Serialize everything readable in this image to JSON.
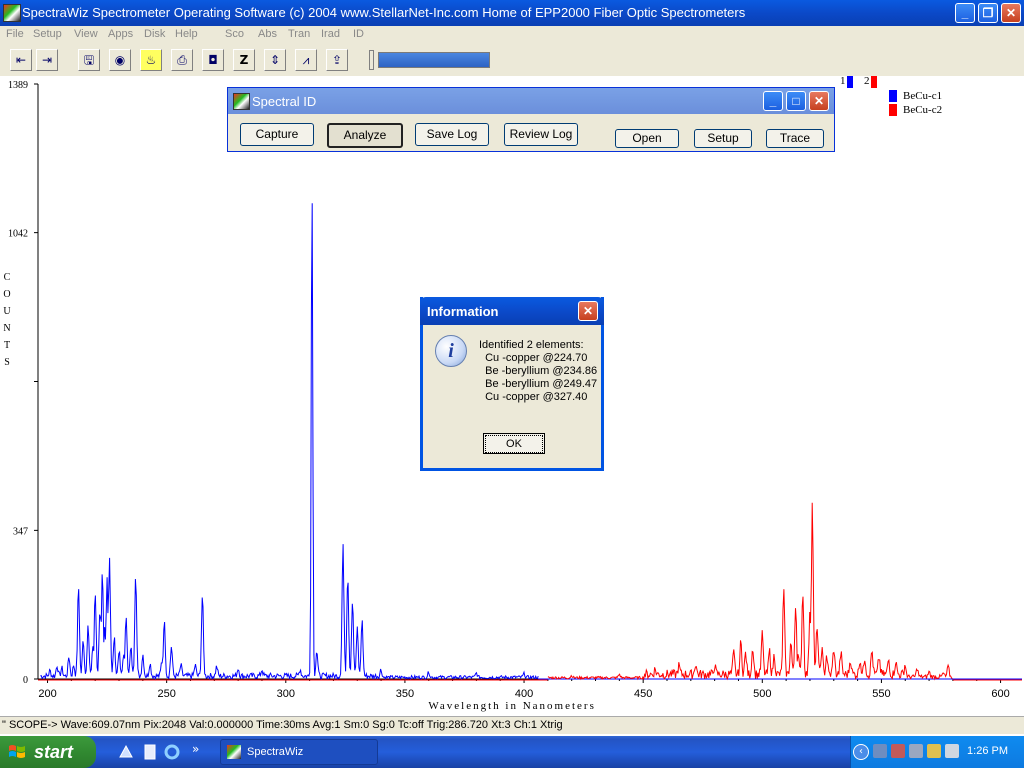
{
  "window": {
    "title": "SpectraWiz  Spectrometer Operating Software (c) 2004  www.StellarNet-Inc.com  Home of EPP2000 Fiber Optic Spectrometers",
    "minimize": "_",
    "restore": "❐",
    "close": "✕"
  },
  "menu": [
    "File",
    "Setup",
    "View",
    "Apps",
    "Disk",
    "Help",
    "Sco",
    "Abs",
    "Tran",
    "Irad",
    "ID"
  ],
  "toolbar": {
    "buttons": [
      {
        "name": "scroll-left-icon",
        "glyph": "⇤"
      },
      {
        "name": "scroll-right-icon",
        "glyph": "⇥"
      },
      {
        "name": "save-icon",
        "glyph": "🖫"
      },
      {
        "name": "lamp-icon",
        "glyph": "◉"
      },
      {
        "name": "bulb-icon",
        "glyph": "♨"
      },
      {
        "name": "print-icon",
        "glyph": "⎙"
      },
      {
        "name": "camera-icon",
        "glyph": "◘"
      },
      {
        "name": "z-icon",
        "glyph": "Z"
      },
      {
        "name": "scale-icon",
        "glyph": "⇕"
      },
      {
        "name": "peak-icon",
        "glyph": "⩘"
      },
      {
        "name": "export-icon",
        "glyph": "⇪"
      }
    ],
    "progress": 1.0
  },
  "legend": [
    {
      "num": "1",
      "label": "BeCu-c1",
      "color": "#0000ff"
    },
    {
      "num": "2",
      "label": "BeCu-c2",
      "color": "#ff0000"
    }
  ],
  "chart_data": {
    "type": "line",
    "xlabel": "Wavelength in Nanometers",
    "ylabel": "COUNTS",
    "xlim": [
      196,
      609
    ],
    "ylim": [
      0,
      1389
    ],
    "x_ticks": [
      200,
      250,
      300,
      350,
      400,
      450,
      500,
      550,
      600
    ],
    "y_ticks": [
      0,
      347,
      1042,
      1389
    ],
    "grid": false,
    "legend_position": "top-right",
    "series": [
      {
        "name": "BeCu-c1",
        "color": "#0000ff",
        "peaks": [
          [
            201,
            12
          ],
          [
            204,
            25
          ],
          [
            206,
            18
          ],
          [
            209,
            45
          ],
          [
            211,
            25
          ],
          [
            213,
            210
          ],
          [
            215,
            85
          ],
          [
            217,
            120
          ],
          [
            219,
            70
          ],
          [
            220,
            195
          ],
          [
            222,
            160
          ],
          [
            223,
            240
          ],
          [
            224,
            110
          ],
          [
            225,
            230
          ],
          [
            226,
            280
          ],
          [
            228,
            90
          ],
          [
            230,
            60
          ],
          [
            232,
            55
          ],
          [
            233,
            140
          ],
          [
            235,
            65
          ],
          [
            237,
            240
          ],
          [
            240,
            50
          ],
          [
            243,
            30
          ],
          [
            248,
            35
          ],
          [
            249,
            130
          ],
          [
            252,
            70
          ],
          [
            256,
            25
          ],
          [
            262,
            25
          ],
          [
            265,
            190
          ],
          [
            271,
            22
          ],
          [
            280,
            18
          ],
          [
            290,
            15
          ],
          [
            306,
            16
          ],
          [
            311,
            1160
          ],
          [
            313,
            60
          ],
          [
            324,
            310
          ],
          [
            326,
            240
          ],
          [
            328,
            180
          ],
          [
            330,
            110
          ],
          [
            332,
            130
          ],
          [
            340,
            15
          ],
          [
            360,
            12
          ],
          [
            380,
            10
          ],
          [
            400,
            8
          ]
        ],
        "baseline_end": 406
      },
      {
        "name": "BeCu-c2",
        "color": "#ff0000",
        "peaks": [
          [
            420,
            5
          ],
          [
            440,
            8
          ],
          [
            455,
            12
          ],
          [
            465,
            20
          ],
          [
            472,
            25
          ],
          [
            480,
            20
          ],
          [
            488,
            50
          ],
          [
            491,
            75
          ],
          [
            493,
            50
          ],
          [
            496,
            65
          ],
          [
            500,
            95
          ],
          [
            503,
            55
          ],
          [
            505,
            45
          ],
          [
            509,
            195
          ],
          [
            512,
            75
          ],
          [
            514,
            165
          ],
          [
            515,
            45
          ],
          [
            517,
            195
          ],
          [
            520,
            155
          ],
          [
            521,
            400
          ],
          [
            523,
            115
          ],
          [
            525,
            60
          ],
          [
            527,
            45
          ],
          [
            530,
            60
          ],
          [
            533,
            50
          ],
          [
            537,
            35
          ],
          [
            541,
            35
          ],
          [
            543,
            40
          ],
          [
            546,
            55
          ],
          [
            549,
            40
          ],
          [
            553,
            35
          ],
          [
            556,
            30
          ],
          [
            560,
            25
          ],
          [
            565,
            20
          ],
          [
            570,
            12
          ],
          [
            576,
            8
          ],
          [
            578,
            25
          ]
        ],
        "baseline_start": 410
      }
    ]
  },
  "status_text": "\" SCOPE->  Wave:609.07nm  Pix:2048  Val:0.000000  Time:30ms  Avg:1  Sm:0  Sg:0  Tc:off  Trig:286.720  Xt:3  Ch:1  Xtrig",
  "spectral_id": {
    "title": "Spectral ID",
    "buttons": {
      "capture": "Capture",
      "analyze": "Analyze",
      "save_log": "Save Log",
      "review_log": "Review Log",
      "open": "Open",
      "setup": "Setup",
      "trace": "Trace"
    }
  },
  "info_dialog": {
    "title": "Information",
    "message": "Identified 2 elements:\n  Cu -copper @224.70\n  Be -beryllium @234.86\n  Be -beryllium @249.47\n  Cu -copper @327.40",
    "ok": "OK"
  },
  "taskbar": {
    "start": "start",
    "task": "SpectraWiz",
    "clock": "1:26 PM"
  }
}
